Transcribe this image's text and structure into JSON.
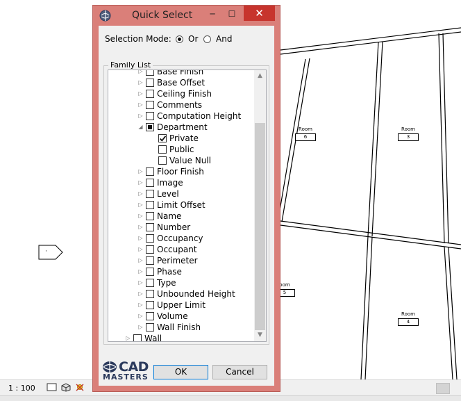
{
  "dialog": {
    "title": "Quick Select",
    "selection_mode_label": "Selection Mode:",
    "mode_options": [
      {
        "label": "Or",
        "selected": true
      },
      {
        "label": "And",
        "selected": false
      }
    ],
    "family_list_label": "Family List",
    "ok_label": "OK",
    "cancel_label": "Cancel",
    "close_glyph": "✕",
    "min_glyph": "─",
    "max_glyph": "☐"
  },
  "tree": [
    {
      "label": "Base Finish",
      "level": 1,
      "expander": "collapsed",
      "state": "unchecked"
    },
    {
      "label": "Base Offset",
      "level": 1,
      "expander": "collapsed",
      "state": "unchecked"
    },
    {
      "label": "Ceiling Finish",
      "level": 1,
      "expander": "collapsed",
      "state": "unchecked"
    },
    {
      "label": "Comments",
      "level": 1,
      "expander": "collapsed",
      "state": "unchecked"
    },
    {
      "label": "Computation Height",
      "level": 1,
      "expander": "collapsed",
      "state": "unchecked"
    },
    {
      "label": "Department",
      "level": 1,
      "expander": "expanded",
      "state": "partial"
    },
    {
      "label": "Private",
      "level": 2,
      "expander": "none",
      "state": "checked"
    },
    {
      "label": "Public",
      "level": 2,
      "expander": "none",
      "state": "unchecked"
    },
    {
      "label": "Value Null",
      "level": 2,
      "expander": "none",
      "state": "unchecked"
    },
    {
      "label": "Floor Finish",
      "level": 1,
      "expander": "collapsed",
      "state": "unchecked"
    },
    {
      "label": "Image",
      "level": 1,
      "expander": "collapsed",
      "state": "unchecked"
    },
    {
      "label": "Level",
      "level": 1,
      "expander": "collapsed",
      "state": "unchecked"
    },
    {
      "label": "Limit Offset",
      "level": 1,
      "expander": "collapsed",
      "state": "unchecked"
    },
    {
      "label": "Name",
      "level": 1,
      "expander": "collapsed",
      "state": "unchecked"
    },
    {
      "label": "Number",
      "level": 1,
      "expander": "collapsed",
      "state": "unchecked"
    },
    {
      "label": "Occupancy",
      "level": 1,
      "expander": "collapsed",
      "state": "unchecked"
    },
    {
      "label": "Occupant",
      "level": 1,
      "expander": "collapsed",
      "state": "unchecked"
    },
    {
      "label": "Perimeter",
      "level": 1,
      "expander": "collapsed",
      "state": "unchecked"
    },
    {
      "label": "Phase",
      "level": 1,
      "expander": "collapsed",
      "state": "unchecked"
    },
    {
      "label": "Type",
      "level": 1,
      "expander": "collapsed",
      "state": "unchecked"
    },
    {
      "label": "Unbounded Height",
      "level": 1,
      "expander": "collapsed",
      "state": "unchecked"
    },
    {
      "label": "Upper Limit",
      "level": 1,
      "expander": "collapsed",
      "state": "unchecked"
    },
    {
      "label": "Volume",
      "level": 1,
      "expander": "collapsed",
      "state": "unchecked"
    },
    {
      "label": "Wall Finish",
      "level": 1,
      "expander": "collapsed",
      "state": "unchecked"
    },
    {
      "label": "Wall",
      "level": 0,
      "expander": "collapsed",
      "state": "unchecked"
    }
  ],
  "logo": {
    "top": "CAD",
    "bottom": "MASTERS"
  },
  "canvas": {
    "rooms": [
      {
        "label": "Room",
        "number": "6"
      },
      {
        "label": "Room",
        "number": "3"
      },
      {
        "label": "oom",
        "number": "5"
      },
      {
        "label": "Room",
        "number": "4"
      }
    ],
    "elevation_marker_text": "·"
  },
  "status_bar": {
    "scale": "1 : 100"
  },
  "colors": {
    "dialog_frame": "#da7f79",
    "close_button": "#c7342d",
    "logo": "#2b3a5c"
  }
}
